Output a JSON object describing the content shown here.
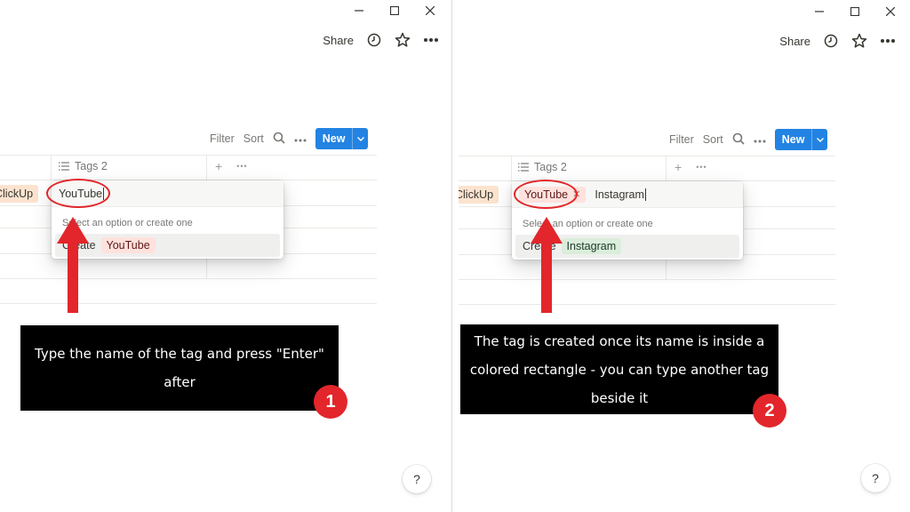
{
  "window_controls": {
    "minimize": "–",
    "maximize": "☐",
    "close": "✕"
  },
  "topbar": {
    "share_label": "Share"
  },
  "toolbar": {
    "filter_label": "Filter",
    "sort_label": "Sort",
    "new_label": "New"
  },
  "table": {
    "tags_column_label": "Tags 2",
    "prev_cell_tag": "ClickUp",
    "add_column_icon": "+",
    "more_icon": "•••"
  },
  "step1": {
    "input_value": "YouTube",
    "hint": "Select an option or create one",
    "create_label": "Create",
    "create_chip": "YouTube",
    "callout": "Type the name of the tag and press \"Enter\" after",
    "badge": "1"
  },
  "step2": {
    "selected_chip": "YouTube",
    "input_value": "Instagram",
    "hint": "Select an option or create one",
    "create_label": "Create",
    "create_chip": "Instagram",
    "callout": "The tag is created once its name is inside a colored rectangle - you can type another tag beside it",
    "badge": "2"
  },
  "help_label": "?",
  "colors": {
    "accent_blue": "#2383e2",
    "annotation_red": "#e2262b",
    "callout_bg": "#000000"
  }
}
